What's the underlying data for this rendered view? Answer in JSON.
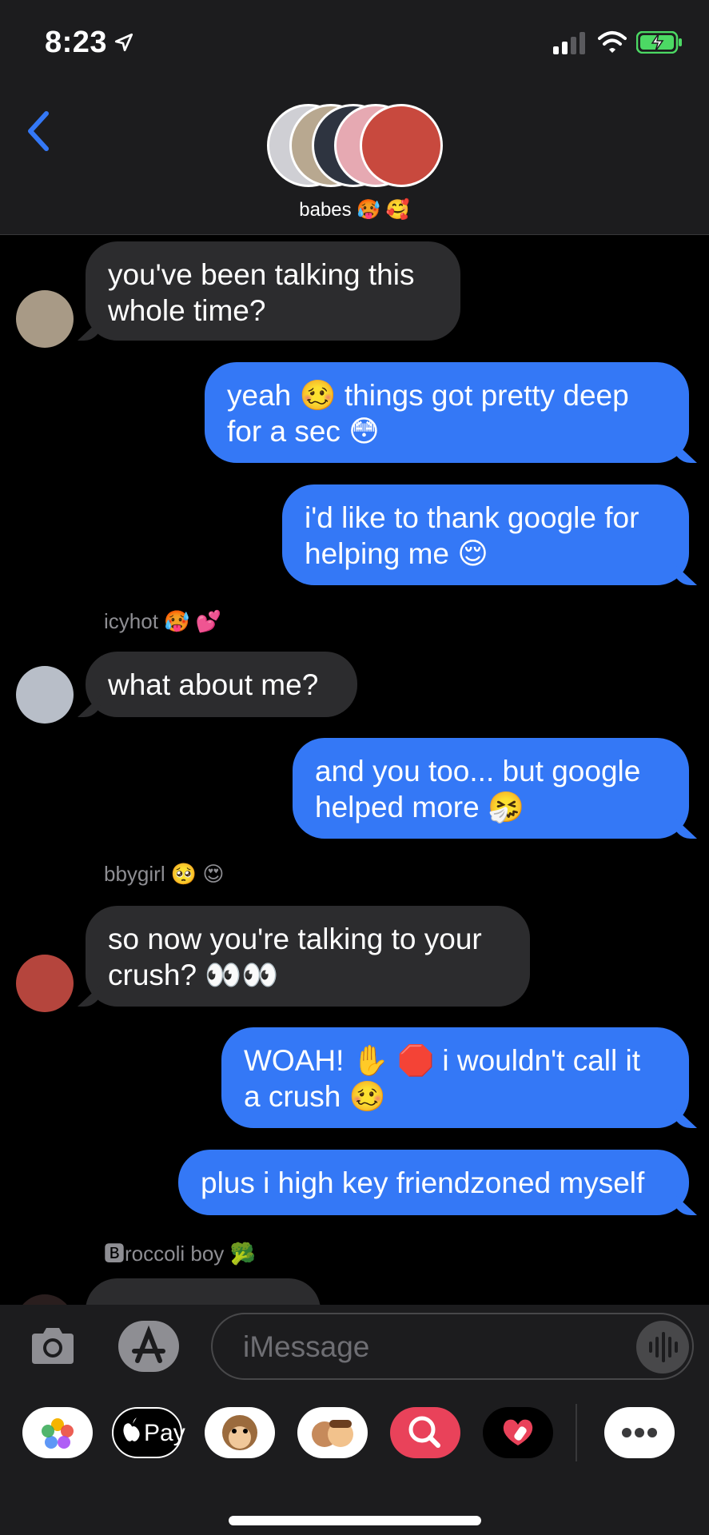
{
  "status_bar": {
    "time": "8:23"
  },
  "header": {
    "group_name": "babes 🥵 🥰"
  },
  "messages": [
    {
      "line1": "you've been talking this",
      "line2": "whole time?"
    },
    {
      "line1": "yeah 🥴 things got pretty deep",
      "line2": "for a sec 😳"
    },
    {
      "line1": "i'd like to thank google for",
      "line2": "helping me 😌"
    },
    {
      "sender": "icyhot 🥵 💕",
      "text": "what about me?"
    },
    {
      "line1": "and you too... but google",
      "line2": "helped more 🤧"
    },
    {
      "sender": "bbygirl 🥺 😍",
      "line1": "so now you're talking to your",
      "line2": "crush? 👀👀"
    },
    {
      "line1": "WOAH! ✋ 🛑 i wouldn't call it",
      "line2": "a crush 🥴"
    },
    {
      "text": "plus i high key friendzoned myself"
    },
    {
      "sender": "🅱roccoli boy 🥦"
    }
  ],
  "input": {
    "placeholder": "iMessage"
  },
  "drawer": {
    "applepay_label": "Pay"
  },
  "icons": [
    "location-arrow-icon",
    "signal-icon",
    "wifi-icon",
    "battery-charging-icon",
    "back-chevron-icon",
    "camera-icon",
    "appstore-icon",
    "audio-icon",
    "photos-icon",
    "applepay-icon",
    "animoji-icon",
    "memoji-icon",
    "search-images-icon",
    "digital-touch-icon",
    "more-icon"
  ],
  "colors": {
    "outgoing": "#3478f6",
    "incoming": "#2c2c2e",
    "accent": "#3478f6",
    "bar": "#1c1c1e"
  }
}
